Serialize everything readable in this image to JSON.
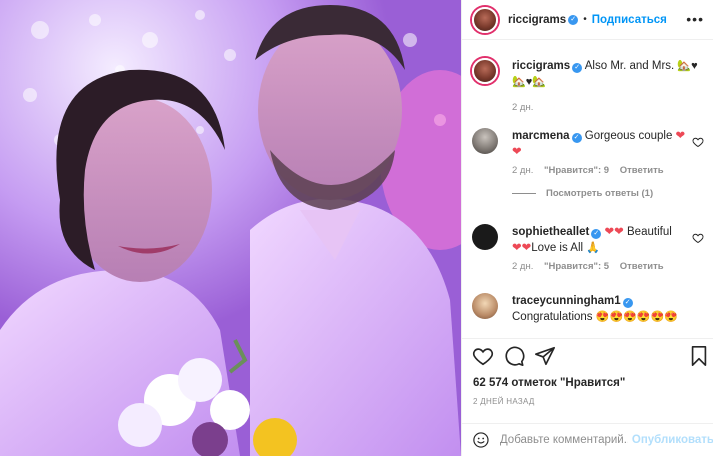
{
  "post": {
    "author": "riccigrams",
    "follow_label": "Подписаться",
    "dot": "•",
    "more": "•••"
  },
  "caption": {
    "username": "riccigrams",
    "text": "Also Mr. and Mrs.",
    "emoji": "🏡♥🏡♥🏡",
    "time": "2 дн."
  },
  "comments": [
    {
      "username": "marcmena",
      "text": "Gorgeous couple",
      "emoji_after": "❤",
      "emoji_line2": "❤",
      "time": "2 дн.",
      "likes": "\"Нравится\": 9",
      "reply": "Ответить",
      "view_replies": "Посмотреть ответы (1)"
    },
    {
      "username": "sophietheallet",
      "emoji_before": "❤❤",
      "text": "Beautiful",
      "emoji_line2_before": "❤❤",
      "text2": "Love is All",
      "emoji_line2_after": "🙏",
      "time": "2 дн.",
      "likes": "\"Нравится\": 5",
      "reply": "Ответить"
    },
    {
      "username": "traceycunningham1",
      "text": "Congratulations",
      "emoji_after": "😍😍😍😍😍😍"
    }
  ],
  "stats": {
    "likes": "62 574 отметок \"Нравится\"",
    "ago": "2 ДНЕЙ НАЗАД"
  },
  "add_comment": {
    "placeholder": "Добавьте комментарий...",
    "publish_label": "Опубликовать"
  },
  "colors": {
    "accent": "#0095f6",
    "heart": "#ed4956",
    "verified": "#3897f0"
  },
  "icons": {
    "like": "heart-outline-icon",
    "comment": "comment-bubble-icon",
    "share": "paper-plane-icon",
    "save": "bookmark-icon",
    "emoji": "smiley-icon"
  }
}
